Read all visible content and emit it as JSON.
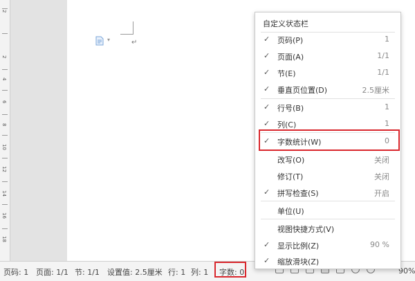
{
  "ruler": {
    "numbers": [
      "2",
      "2",
      "4",
      "6",
      "8",
      "10",
      "12",
      "14",
      "16",
      "18"
    ]
  },
  "document": {
    "icon": "document-icon",
    "paragraph_mark": "↵"
  },
  "statusbar": {
    "page_no": "页码: 1",
    "page_count": "页面: 1/1",
    "section": "节: 1/1",
    "setting": "设置值: 2.5厘米",
    "line": "行: 1",
    "column": "列: 1",
    "word_count": "字数: 0",
    "zoom": "90%"
  },
  "menu": {
    "title": "自定义状态栏",
    "items": [
      {
        "label": "页码(P)",
        "value": "1",
        "checked": "✓"
      },
      {
        "label": "页面(A)",
        "value": "1/1",
        "checked": "✓"
      },
      {
        "label": "节(E)",
        "value": "1/1",
        "checked": "✓"
      },
      {
        "label": "垂直页位置(D)",
        "value": "2.5厘米",
        "checked": "✓"
      },
      {
        "label": "行号(B)",
        "value": "1",
        "checked": "✓"
      },
      {
        "label": "列(C)",
        "value": "1",
        "checked": "✓"
      },
      {
        "label": "字数统计(W)",
        "value": "0",
        "checked": "✓"
      },
      {
        "label": "改写(O)",
        "value": "关闭",
        "checked": ""
      },
      {
        "label": "修订(T)",
        "value": "关闭",
        "checked": ""
      },
      {
        "label": "拼写检查(S)",
        "value": "开启",
        "checked": "✓"
      },
      {
        "label": "单位(U)",
        "value": "",
        "checked": ""
      },
      {
        "label": "视图快捷方式(V)",
        "value": "",
        "checked": ""
      },
      {
        "label": "显示比例(Z)",
        "value": "90 %",
        "checked": "✓"
      },
      {
        "label": "缩放滑块(Z)",
        "value": "",
        "checked": "✓"
      }
    ]
  },
  "colors": {
    "highlight": "#d9262c",
    "accent_icon": "#7aa6d8"
  }
}
